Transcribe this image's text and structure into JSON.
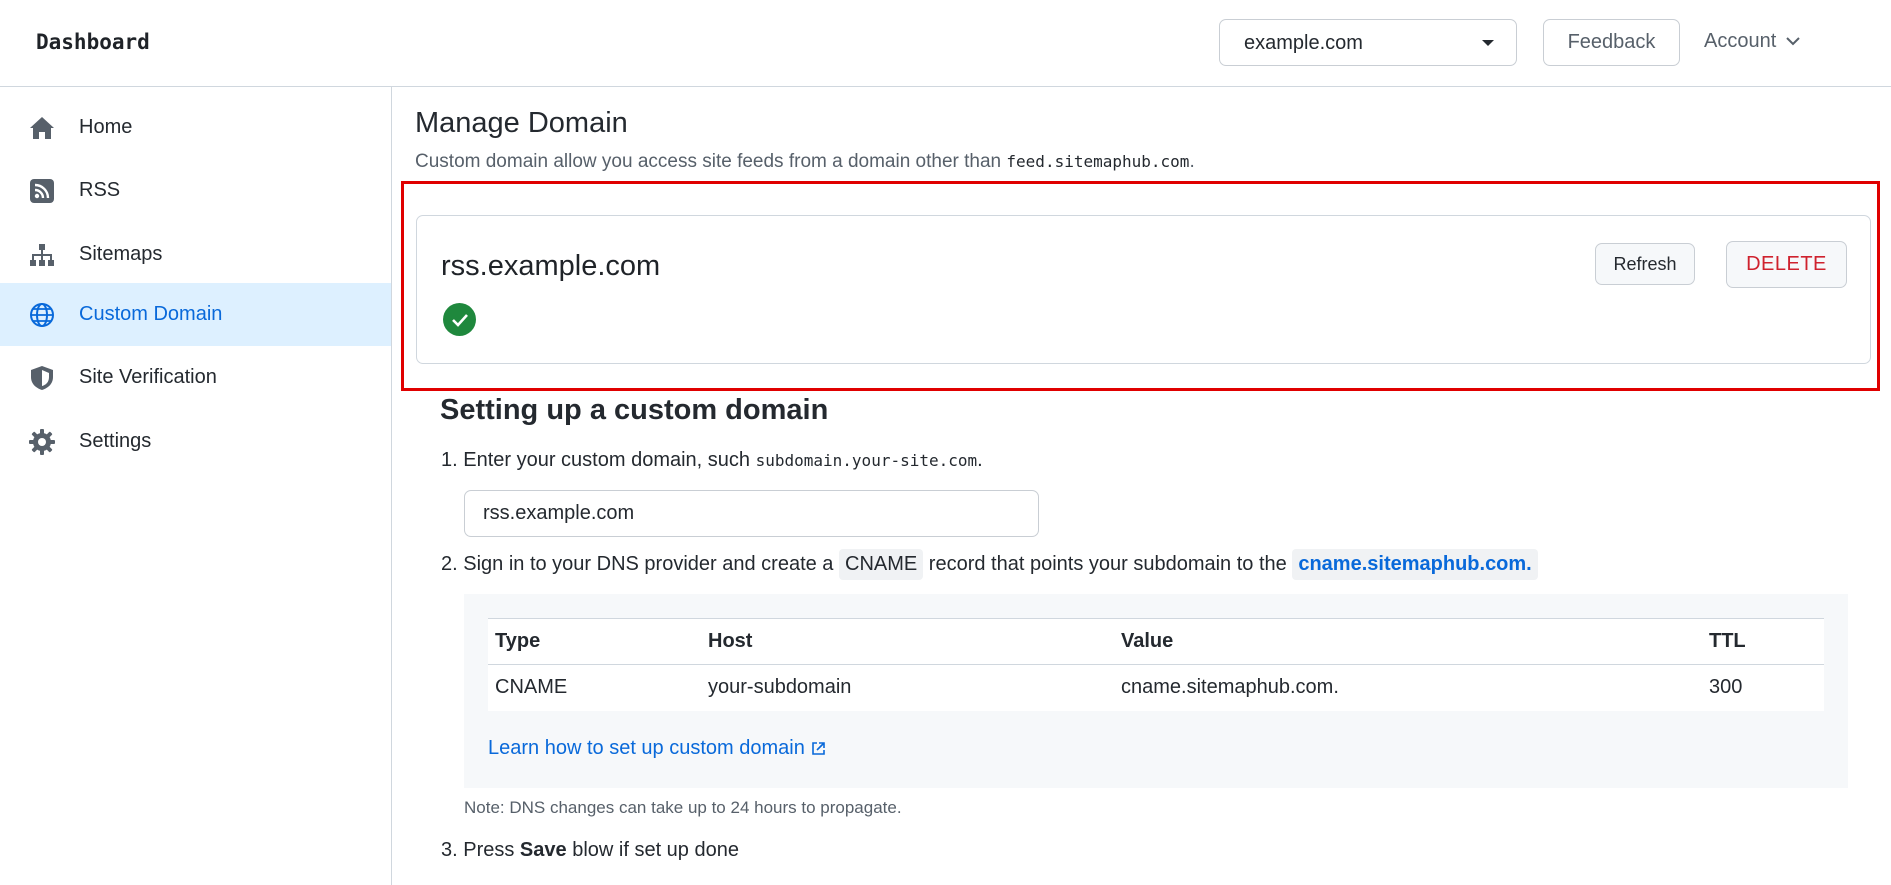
{
  "header": {
    "brand": "Dashboard",
    "site_select_value": "example.com",
    "feedback_label": "Feedback",
    "account_label": "Account"
  },
  "sidebar": {
    "items": [
      {
        "label": "Home",
        "icon": "home-icon"
      },
      {
        "label": "RSS",
        "icon": "rss-icon"
      },
      {
        "label": "Sitemaps",
        "icon": "sitemap-icon"
      },
      {
        "label": "Custom Domain",
        "icon": "globe-icon",
        "active": true
      },
      {
        "label": "Site Verification",
        "icon": "shield-icon"
      },
      {
        "label": "Settings",
        "icon": "gear-icon"
      }
    ]
  },
  "main": {
    "title": "Manage Domain",
    "description_prefix": "Custom domain allow you access site feeds from a domain other than ",
    "description_code": "feed.sitemaphub.com",
    "description_suffix": ".",
    "domain_card": {
      "domain": "rss.example.com",
      "status_icon": "check-circle-icon",
      "refresh_label": "Refresh",
      "delete_label": "DELETE"
    },
    "setup": {
      "title": "Setting up a custom domain",
      "step1_prefix": "1. Enter your custom domain, such ",
      "step1_code": "subdomain.your-site.com",
      "step1_suffix": ".",
      "input_value": "rss.example.com",
      "step2_prefix": "2. Sign in to your DNS provider and create a ",
      "step2_record": "CNAME",
      "step2_middle": " record that points your subdomain to the ",
      "step2_target": "cname.sitemaphub.com.",
      "table": {
        "headers": [
          "Type",
          "Host",
          "Value",
          "TTL"
        ],
        "row": [
          "CNAME",
          "your-subdomain",
          "cname.sitemaphub.com.",
          "300"
        ]
      },
      "learn_link": "Learn how to set up custom domain",
      "note": "Note: DNS changes can take up to 24 hours to propagate.",
      "step3_prefix": "3. Press ",
      "step3_bold": "Save",
      "step3_suffix": " blow if set up done"
    }
  },
  "colors": {
    "accent": "#0969da",
    "active_bg": "#ddf0ff",
    "danger": "#cf222e",
    "success": "#1f883d",
    "highlight": "#e00000"
  }
}
